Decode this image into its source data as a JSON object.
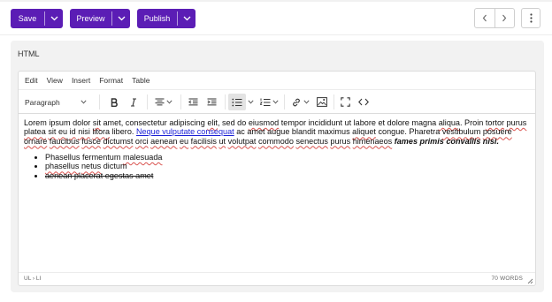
{
  "actions": {
    "save_label": "Save",
    "preview_label": "Preview",
    "publish_label": "Publish"
  },
  "panel": {
    "label": "HTML"
  },
  "editor": {
    "menu": [
      "Edit",
      "View",
      "Insert",
      "Format",
      "Table"
    ],
    "block_format": "Paragraph",
    "content": {
      "p1": "Lorem",
      "p2": "ipsum",
      "p3": "dolor",
      "p4": "sit",
      "p5": "amet",
      "p6": ", consectetur",
      "p7": "adipiscing",
      "p8": "elit",
      "p9": ", sed do",
      "p10": "eiusmod",
      "p11": "tempor",
      "p12": "incididunt",
      "p13": "ut labore et dolore magna",
      "p14": "aliqua",
      "p15": ". Proin",
      "p16": "tortor",
      "p17": "purus",
      "p18": "platea",
      "p19": "sit",
      "p20": "eu",
      "p21": "id",
      "p22": "nisi",
      "p23": "litora",
      "p24": "libero.",
      "link": "Neque vulputate consequat",
      "p25": "ac amet augue blandit maximus",
      "p26": "aliquet",
      "p27": "congue. Pharetra",
      "p28": "vestibulum",
      "p29": "posuere",
      "p30": "ornare",
      "p31": "faucibus",
      "p32": "fusce",
      "p33": "dictumst",
      "p34": "orci",
      "p35": "aenean",
      "p36": "eu",
      "p37": "facilisis",
      "p38": "ut",
      "p39": "volutpat",
      "p40": "commodo",
      "p41": "senectus",
      "p42": "purus",
      "p43": "himenaeos",
      "bold_italic": "fames primis convallis nisi.",
      "list": [
        {
          "w1": "Phasellus",
          "w2": "fermentum",
          "w3": "malesuada"
        },
        {
          "w1": "phasellus",
          "w2": "netus",
          "w3": "dictum"
        },
        {
          "w1": "aenean",
          "w2": "placerat",
          "w3": "egestas",
          "w4": "amet"
        }
      ]
    },
    "status": {
      "path": "UL › LI",
      "word_count": "70 WORDS"
    }
  },
  "colors": {
    "accent": "#5b1db5",
    "link": "#1a1fd6",
    "spellcheck": "#d9534f"
  },
  "icons": [
    "chevron-down-icon",
    "chevron-left-icon",
    "chevron-right-icon",
    "more-vertical-icon",
    "bold-icon",
    "italic-icon",
    "align-icon",
    "outdent-icon",
    "indent-icon",
    "bullet-list-icon",
    "numbered-list-icon",
    "link-icon",
    "image-icon",
    "fullscreen-icon",
    "code-icon",
    "resize-handle-icon"
  ]
}
